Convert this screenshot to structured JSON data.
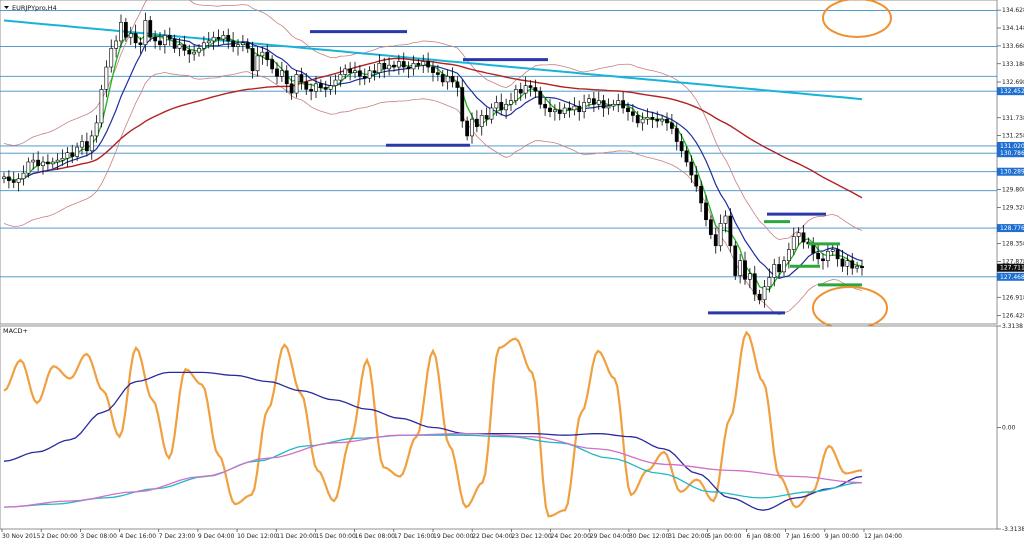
{
  "chart_data": [
    {
      "type": "candlestick",
      "title": "EURJPYpro,H4",
      "symbol": "EURJPY",
      "timeframe": "H4",
      "ylim": [
        126.2,
        134.9
      ],
      "y_ticks": [
        134.628,
        134.148,
        133.668,
        133.188,
        132.698,
        131.738,
        131.258,
        130.298,
        129.808,
        129.328,
        128.358,
        127.878,
        126.918,
        126.428
      ],
      "price_tags": [
        {
          "label": "132.452",
          "value": 132.452,
          "bg": "#1e6fd0",
          "fg": "#ffffff"
        },
        {
          "label": "131.020",
          "value": 130.98,
          "bg": "#1e6fd0",
          "fg": "#ffffff"
        },
        {
          "label": "130.786",
          "value": 130.786,
          "bg": "#1e6fd0",
          "fg": "#ffffff"
        },
        {
          "label": "130.289",
          "value": 130.289,
          "bg": "#1e6fd0",
          "fg": "#ffffff"
        },
        {
          "label": "128.776",
          "value": 128.776,
          "bg": "#1e6fd0",
          "fg": "#ffffff"
        },
        {
          "label": "127.711",
          "value": 127.711,
          "bg": "#111111",
          "fg": "#ffffff"
        },
        {
          "label": "127.468",
          "value": 127.468,
          "bg": "#1e6fd0",
          "fg": "#ffffff"
        }
      ],
      "horizontal_levels": [
        134.62,
        133.65,
        132.85,
        132.452,
        130.98,
        130.786,
        130.289,
        129.78,
        128.776,
        127.468
      ],
      "x_tick_labels": [
        "30 Nov 2015",
        "2 Dec 00:00",
        "3 Dec 08:00",
        "4 Dec 16:00",
        "7 Dec 23:00",
        "9 Dec 04:00",
        "10 Dec 12:00",
        "11 Dec 20:00",
        "15 Dec 00:00",
        "16 Dec 08:00",
        "17 Dec 16:00",
        "19 Dec 00:00",
        "22 Dec 04:00",
        "23 Dec 12:00",
        "24 Dec 20:00",
        "29 Dec 04:00",
        "30 Dec 12:00",
        "31 Dec 20:00",
        "5 Jan 00:00",
        "6 Jan 08:00",
        "7 Jan 16:00",
        "9 Jan 00:00",
        "12 Jan 04:00"
      ],
      "series": [
        {
          "style": "candles",
          "values": [
            130.15,
            130.05,
            130.0,
            130.1,
            130.25,
            130.55,
            130.6,
            130.45,
            130.55,
            130.5,
            130.55,
            130.6,
            130.65,
            130.8,
            130.7,
            130.95,
            131.1,
            130.85,
            131.25,
            131.6,
            132.5,
            133.1,
            133.6,
            133.8,
            134.3,
            133.9,
            134.0,
            133.75,
            133.7,
            134.35,
            133.9,
            133.8,
            133.7,
            133.95,
            133.85,
            133.6,
            133.7,
            133.55,
            133.45,
            133.5,
            133.6,
            133.75,
            133.8,
            133.9,
            133.85,
            133.95,
            133.8,
            133.65,
            133.7,
            133.75,
            133.6,
            133.0,
            133.4,
            133.5,
            133.3,
            133.05,
            132.85,
            133.0,
            132.65,
            132.4,
            132.9,
            132.7,
            132.5,
            132.45,
            132.65,
            132.55,
            132.5,
            132.6,
            132.75,
            132.9,
            133.05,
            132.95,
            133.0,
            132.85,
            132.8,
            133.0,
            132.95,
            133.2,
            133.05,
            133.15,
            133.1,
            133.25,
            133.1,
            133.05,
            133.2,
            133.15,
            133.25,
            133.1,
            132.95,
            132.9,
            132.7,
            132.85,
            132.7,
            132.55,
            131.65,
            131.25,
            131.7,
            131.5,
            131.8,
            131.7,
            132.0,
            132.15,
            131.95,
            132.1,
            132.2,
            132.5,
            132.4,
            132.6,
            132.55,
            132.45,
            132.1,
            132.0,
            131.9,
            131.95,
            131.85,
            132.0,
            131.95,
            132.05,
            131.9,
            132.15,
            132.25,
            132.1,
            132.2,
            132.0,
            132.05,
            132.1,
            132.2,
            132.0,
            131.9,
            131.8,
            131.6,
            131.7,
            131.75,
            131.7,
            131.65,
            131.7,
            131.6,
            131.45,
            131.1,
            130.85,
            130.55,
            130.2,
            129.9,
            129.45,
            129.0,
            128.6,
            128.3,
            128.9,
            129.1,
            128.3,
            127.5,
            127.9,
            127.4,
            127.55,
            127.0,
            126.85,
            127.2,
            127.45,
            127.8,
            127.6,
            127.9,
            128.2,
            128.55,
            128.65,
            128.4,
            128.35,
            128.1,
            127.95,
            127.9,
            128.15,
            128.2,
            127.95,
            127.75,
            127.9,
            127.7,
            127.75,
            127.71
          ]
        }
      ],
      "chart_marks": {
        "ma_slow": "#18b4d8",
        "ma_mid": "#b22222",
        "ma_fast": "#22b222",
        "ma_medium": "#1f2ea0",
        "envelope": "#c98080",
        "level_lines": "#3a8fc8",
        "marker_blue": "#2a38a8",
        "marker_green": "#2aa83a",
        "circles": "#f09030"
      },
      "grid": false
    },
    {
      "type": "line",
      "title": "MACD+",
      "ylim": [
        -3.3138,
        3.3138
      ],
      "y_ticks": [
        3.3138,
        0.0,
        -3.3138
      ],
      "y_tick_labels": [
        "3.3138",
        "0.00",
        "-3.3138"
      ],
      "series": [
        {
          "style": "orange-oscillator",
          "color": "#f0a040",
          "values": [
            1.2,
            2.2,
            0.8,
            2.0,
            1.6,
            2.4,
            1.2,
            -0.3,
            2.6,
            0.9,
            -1.0,
            1.9,
            1.4,
            -0.9,
            -2.5,
            -2.2,
            0.6,
            2.7,
            1.1,
            -1.4,
            -2.4,
            -0.4,
            2.2,
            -1.3,
            -1.6,
            -0.3,
            2.5,
            -0.6,
            -2.6,
            -1.8,
            2.6,
            2.9,
            1.8,
            -2.9,
            -2.7,
            0.5,
            2.5,
            1.6,
            -2.2,
            -1.4,
            -0.8,
            -2.1,
            -1.7,
            -2.4,
            0.3,
            3.1,
            1.5,
            -1.6,
            -2.6,
            -2.1,
            -0.6,
            -1.5,
            -1.4
          ]
        },
        {
          "style": "navy-signal",
          "color": "#2a2aa0",
          "values": [
            -1.1,
            -0.8,
            -0.4,
            0.5,
            1.5,
            1.8,
            1.8,
            1.7,
            1.5,
            1.2,
            0.9,
            0.6,
            0.3,
            0.0,
            -0.2,
            -0.2,
            -0.2,
            -0.25,
            -0.2,
            -0.3,
            -0.7,
            -1.5,
            -2.3,
            -2.7,
            -2.3,
            -2.0,
            -1.6
          ]
        },
        {
          "style": "cyan-slow",
          "color": "#20b8c8",
          "values": [
            -2.6,
            -2.5,
            -2.3,
            -2.0,
            -1.6,
            -1.1,
            -0.6,
            -0.35,
            -0.25,
            -0.25,
            -0.3,
            -0.5,
            -1.0,
            -1.5,
            -2.1,
            -2.3,
            -2.1,
            -1.8
          ]
        },
        {
          "style": "magenta-slow",
          "color": "#d070c8",
          "values": [
            -2.6,
            -2.4,
            -2.1,
            -1.6,
            -1.0,
            -0.5,
            -0.25,
            -0.2,
            -0.3,
            -0.7,
            -1.2,
            -1.4,
            -1.6,
            -1.8
          ]
        }
      ]
    }
  ]
}
